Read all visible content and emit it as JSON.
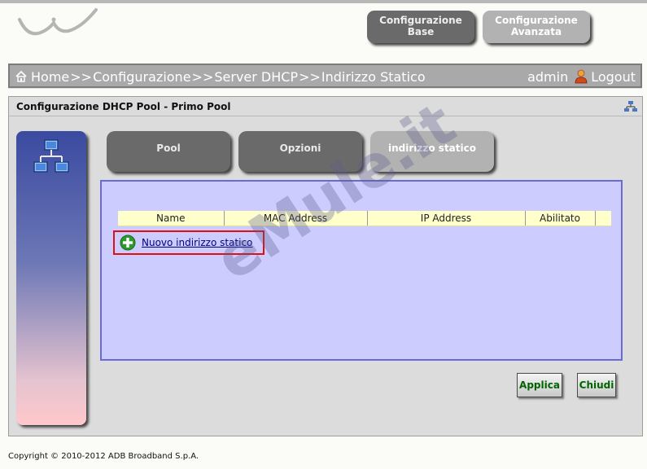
{
  "header": {
    "btn_base": [
      "Configurazione",
      "Base"
    ],
    "btn_advanced": [
      "Configurazione",
      "Avanzata"
    ]
  },
  "breadcrumb": {
    "items": [
      "Home",
      "Configurazione",
      "Server DHCP",
      "Indirizzo Statico"
    ],
    "separator": ">>"
  },
  "user": {
    "name": "admin",
    "logout_label": "Logout"
  },
  "panel": {
    "title": "Configurazione DHCP Pool - Primo Pool"
  },
  "tabs": [
    {
      "label": "Pool",
      "active": false
    },
    {
      "label": "Opzioni",
      "active": false
    },
    {
      "label": "indirizzo statico",
      "active": true
    }
  ],
  "table": {
    "columns": [
      "Name",
      "MAC Address",
      "IP Address",
      "Abilitato",
      ""
    ]
  },
  "new_static_link": "Nuovo indirizzo statico",
  "watermark": "eMule.it",
  "buttons": {
    "apply": "Applica",
    "close": "Chiudi"
  },
  "footer": "Copyright © 2010-2012 ADB Broadband S.p.A.",
  "colors": {
    "accent_green": "#006400",
    "content_bg": "#ccccff",
    "highlight_red": "#e01010"
  },
  "icons": [
    "home-icon",
    "user-icon",
    "network-icon",
    "plus-icon",
    "logo-icon"
  ]
}
